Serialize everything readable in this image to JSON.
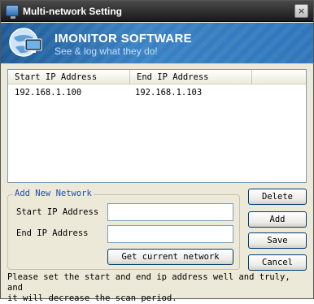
{
  "window": {
    "title": "Multi-network Setting",
    "close_label": "×"
  },
  "banner": {
    "brand": "IMONITOR SOFTWARE",
    "slogan": "See & log what they do!"
  },
  "network_list": {
    "columns": [
      "Start IP Address",
      "End IP Address"
    ],
    "rows": [
      {
        "start": "192.168.1.100",
        "end": "192.168.1.103"
      }
    ]
  },
  "add_network": {
    "legend": "Add New Network",
    "start_label": "Start IP Address",
    "end_label": "End IP Address",
    "start_value": "",
    "end_value": "",
    "get_current_label": "Get current network"
  },
  "buttons": {
    "delete": "Delete",
    "add": "Add",
    "save": "Save",
    "cancel": "Cancel"
  },
  "hint": "Please set the start and end ip address well and truly, and\nit will decrease the scan period.",
  "colors": {
    "banner": "#2f76bb",
    "legend": "#1f4fb7",
    "dialog_bg": "#ece9d8"
  }
}
